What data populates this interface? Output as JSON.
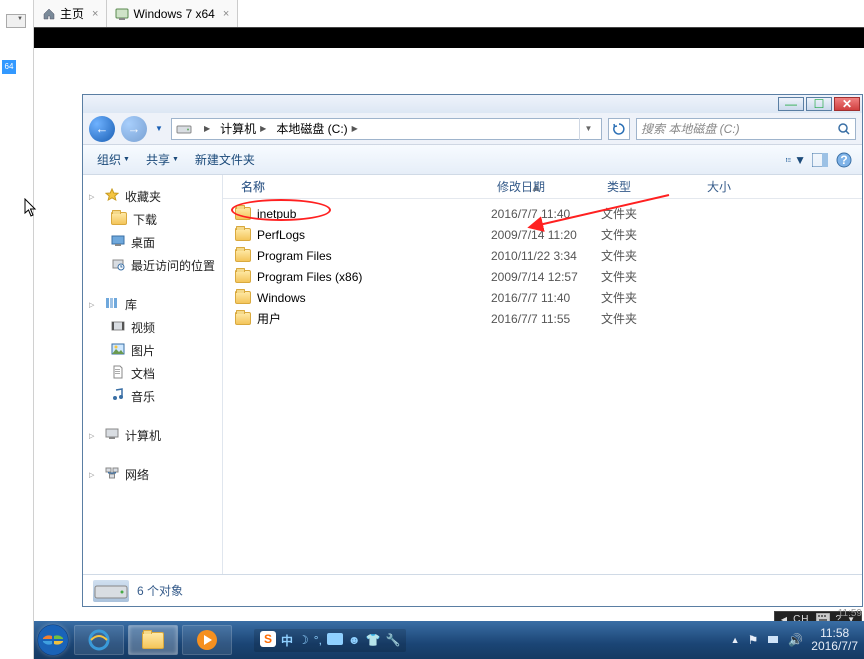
{
  "tabs": [
    {
      "label": "主页",
      "icon": "home-icon"
    },
    {
      "label": "Windows 7 x64",
      "icon": "vm-icon"
    }
  ],
  "leftStrip": {
    "tag": "64"
  },
  "explorer": {
    "winButtons": {
      "min": "—",
      "max": "☐",
      "close": "✕"
    },
    "address": {
      "parts": [
        "计算机",
        "本地磁盘 (C:)"
      ]
    },
    "search": {
      "placeholder": "搜索 本地磁盘 (C:)"
    },
    "toolbar": {
      "organize": "组织",
      "share": "共享",
      "newfolder": "新建文件夹"
    },
    "nav": {
      "favorites": {
        "label": "收藏夹",
        "items": [
          "下载",
          "桌面",
          "最近访问的位置"
        ]
      },
      "libraries": {
        "label": "库",
        "items": [
          "视频",
          "图片",
          "文档",
          "音乐"
        ]
      },
      "computer": {
        "label": "计算机"
      },
      "network": {
        "label": "网络"
      }
    },
    "columns": {
      "name": "名称",
      "date": "修改日期",
      "type": "类型",
      "size": "大小"
    },
    "files": [
      {
        "name": "inetpub",
        "date": "2016/7/7 11:40",
        "type": "文件夹"
      },
      {
        "name": "PerfLogs",
        "date": "2009/7/14 11:20",
        "type": "文件夹"
      },
      {
        "name": "Program Files",
        "date": "2010/11/22 3:34",
        "type": "文件夹"
      },
      {
        "name": "Program Files (x86)",
        "date": "2009/7/14 12:57",
        "type": "文件夹"
      },
      {
        "name": "Windows",
        "date": "2016/7/7 11:40",
        "type": "文件夹"
      },
      {
        "name": "用户",
        "date": "2016/7/7 11:55",
        "type": "文件夹"
      }
    ],
    "status": "6 个对象"
  },
  "vmLangbar": {
    "lang": "CH"
  },
  "imeRow": {
    "zhong": "中"
  },
  "tray": {
    "time": "11:58",
    "date": "2016/7/7"
  },
  "bottomClock": "11:59"
}
